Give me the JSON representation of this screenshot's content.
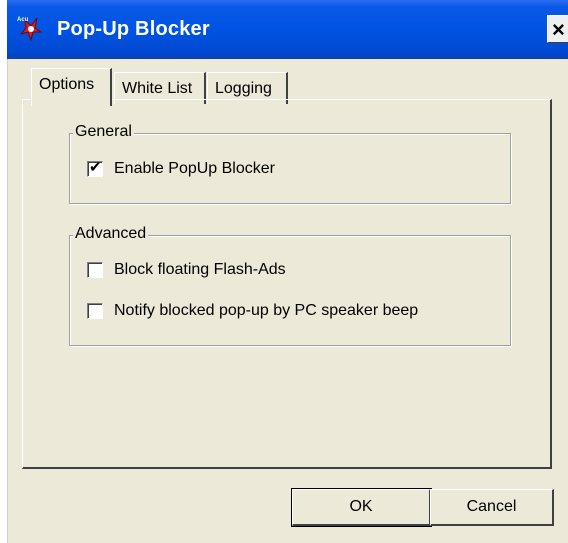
{
  "window": {
    "title": "Pop-Up Blocker",
    "icon": "acu-app-icon",
    "close_label": "×"
  },
  "tabs": [
    {
      "label": "Options",
      "active": true
    },
    {
      "label": "White List",
      "active": false
    },
    {
      "label": "Logging",
      "active": false
    }
  ],
  "general": {
    "title": "General",
    "options": [
      {
        "label": "Enable PopUp Blocker",
        "checked": true
      }
    ]
  },
  "advanced": {
    "title": "Advanced",
    "options": [
      {
        "label": "Block floating Flash-Ads",
        "checked": false
      },
      {
        "label": "Notify blocked pop-up by PC speaker beep",
        "checked": false
      }
    ]
  },
  "buttons": {
    "ok": "OK",
    "cancel": "Cancel"
  },
  "colors": {
    "titlebar": "#0054e3",
    "dialog_bg": "#ece9d8"
  }
}
